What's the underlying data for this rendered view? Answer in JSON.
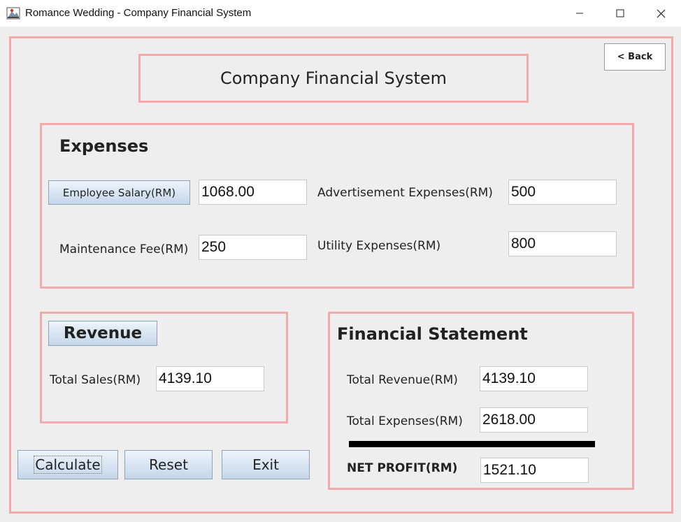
{
  "window": {
    "title": "Romance Wedding - Company Financial System",
    "icon": "java-app-icon",
    "controls": [
      "minimize-icon",
      "maximize-icon",
      "close-icon"
    ]
  },
  "header": {
    "system_title": "Company Financial System",
    "back_label": "< Back"
  },
  "expenses": {
    "heading": "Expenses",
    "employee_salary_label": "Employee Salary(RM)",
    "employee_salary_value": "1068.00",
    "advertisement_label": "Advertisement Expenses(RM)",
    "advertisement_value": "500",
    "maintenance_label": "Maintenance Fee(RM)",
    "maintenance_value": "250",
    "utility_label": "Utility Expenses(RM)",
    "utility_value": "800"
  },
  "revenue": {
    "heading": "Revenue",
    "total_sales_label": "Total Sales(RM)",
    "total_sales_value": "4139.10"
  },
  "statement": {
    "heading": "Financial Statement",
    "total_revenue_label": "Total Revenue(RM)",
    "total_revenue_value": "4139.10",
    "total_expenses_label": "Total Expenses(RM)",
    "total_expenses_value": "2618.00",
    "net_profit_label": "NET PROFIT(RM)",
    "net_profit_value": "1521.10"
  },
  "actions": {
    "calculate": "Calculate",
    "reset": "Reset",
    "exit": "Exit"
  },
  "colors": {
    "frame_pink": "#f4aaaa",
    "background": "#eeeeee",
    "button_gradient_top": "#eef4fa",
    "button_gradient_bottom": "#c4d6ea"
  }
}
